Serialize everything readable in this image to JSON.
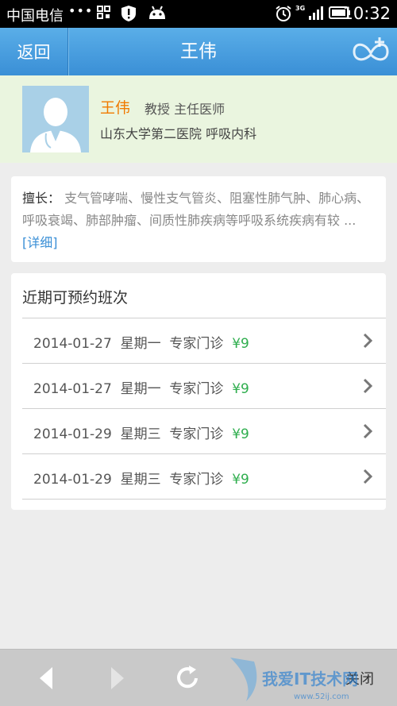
{
  "status_bar": {
    "carrier": "中国电信",
    "dots": "•••",
    "network": "3G",
    "time": "10:32"
  },
  "header": {
    "back_label": "返回",
    "title": "王伟"
  },
  "doctor": {
    "name": "王伟",
    "title": "教授 主任医师",
    "hospital": "山东大学第二医院 呼吸内科"
  },
  "specialty": {
    "label": "擅长：",
    "text": "支气管哮喘、慢性支气管炎、阻塞性肺气肿、肺心病、呼吸衰竭、肺部肿瘤、间质性肺疾病等呼吸系统疾病有较 ...",
    "more": "[详细]"
  },
  "schedule": {
    "title": "近期可预约班次",
    "rows": [
      {
        "date": "2014-01-27",
        "weekday": "星期一",
        "type": "专家门诊",
        "price": "¥9"
      },
      {
        "date": "2014-01-27",
        "weekday": "星期一",
        "type": "专家门诊",
        "price": "¥9"
      },
      {
        "date": "2014-01-29",
        "weekday": "星期三",
        "type": "专家门诊",
        "price": "¥9"
      },
      {
        "date": "2014-01-29",
        "weekday": "星期三",
        "type": "专家门诊",
        "price": "¥9"
      }
    ]
  },
  "toolbar": {
    "close_label": "关闭",
    "watermark": "我爱IT技术网"
  },
  "colors": {
    "header": "#3a8fd6",
    "doctor_name": "#f07a00",
    "price": "#2fae4e",
    "link": "#3a8fd6"
  }
}
